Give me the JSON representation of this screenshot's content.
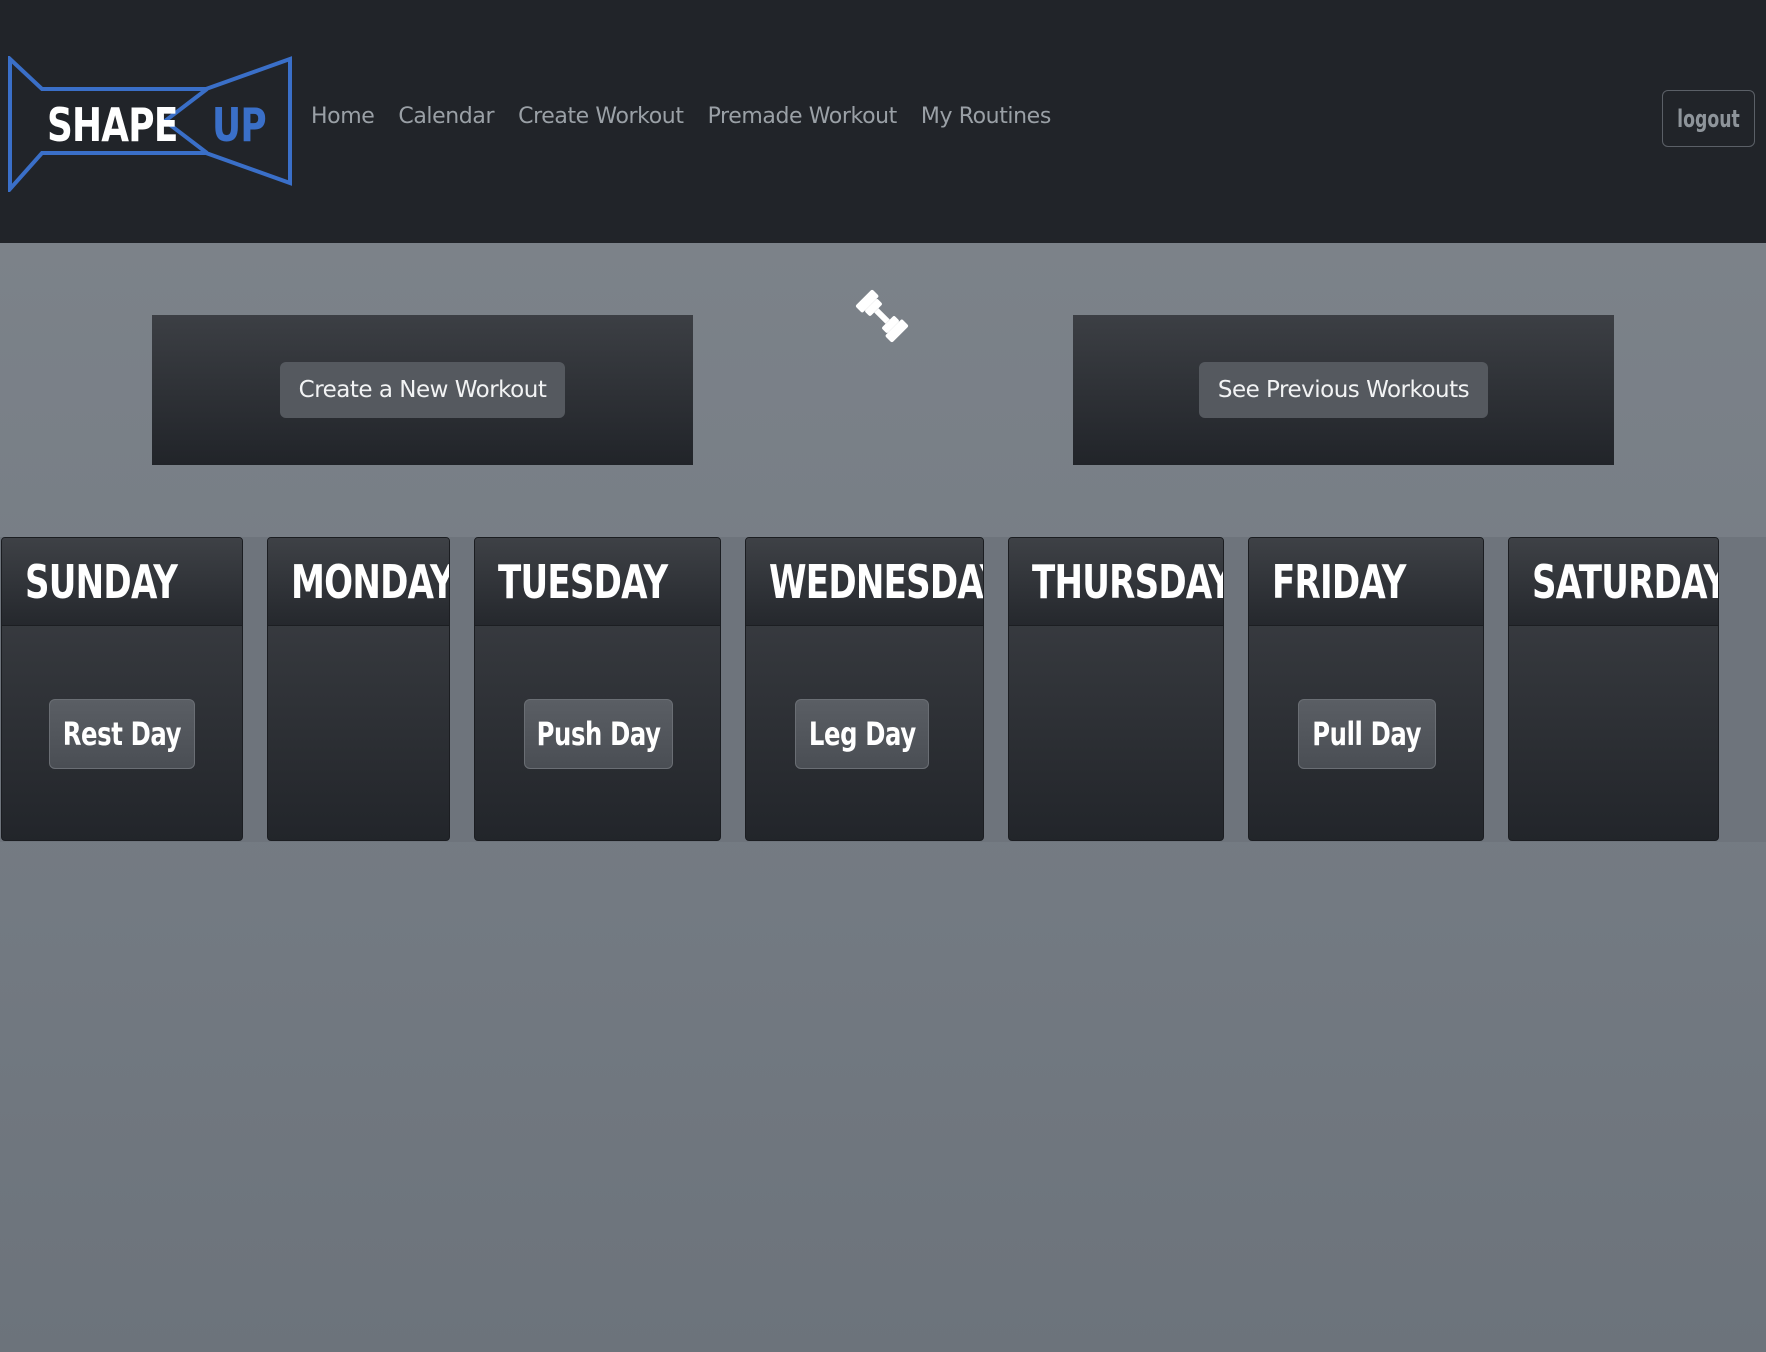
{
  "brand": {
    "word1": "SHAPE",
    "word2": "UP",
    "accent_color": "#3a6fc8"
  },
  "nav": {
    "items": [
      "Home",
      "Calendar",
      "Create Workout",
      "Premade Workout",
      "My Routines"
    ]
  },
  "header": {
    "logout_label": "logout"
  },
  "actions": {
    "create_label": "Create a New Workout",
    "previous_label": "See Previous Workouts",
    "center_icon": "dumbbell-icon"
  },
  "week": {
    "days": [
      {
        "name": "SUNDAY",
        "workout": "Rest Day"
      },
      {
        "name": "MONDAY",
        "workout": ""
      },
      {
        "name": "TUESDAY",
        "workout": "Push Day"
      },
      {
        "name": "WEDNESDAY",
        "workout": "Leg Day"
      },
      {
        "name": "THURSDAY",
        "workout": ""
      },
      {
        "name": "FRIDAY",
        "workout": "Pull Day"
      },
      {
        "name": "SATURDAY",
        "workout": ""
      }
    ]
  }
}
